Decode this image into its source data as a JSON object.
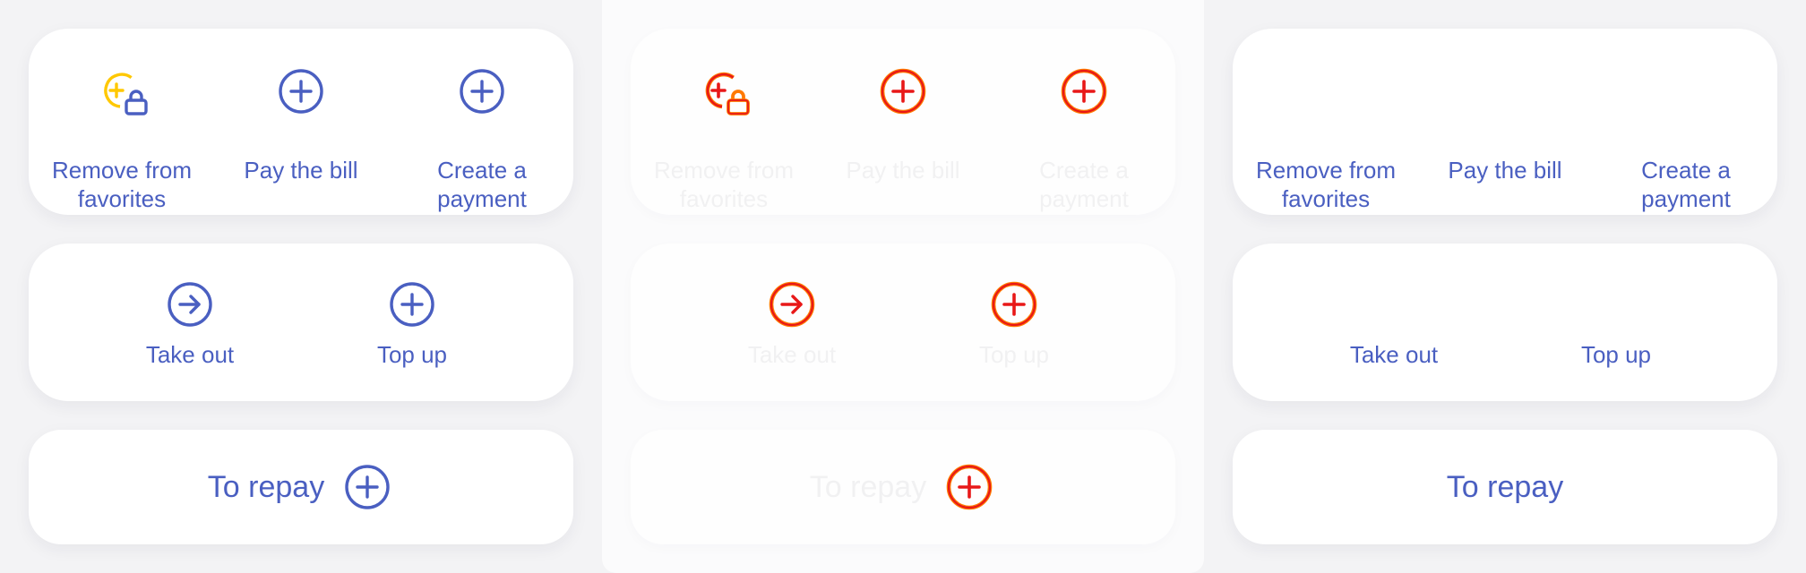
{
  "colors": {
    "blue": "#4a5fc1",
    "red": "#e81818",
    "orange": "#ff7a00",
    "yellow": "#ffc800",
    "faded_text": "#f1f1f2",
    "card": "#ffffff",
    "background": "#f3f3f5"
  },
  "variants": [
    {
      "top_card": [
        {
          "label": "Remove from favorites",
          "icon": "add-lock-icon"
        },
        {
          "label": "Pay the bill",
          "icon": "plus-circle-icon"
        },
        {
          "label": "Create a payment",
          "icon": "plus-circle-icon"
        }
      ],
      "mid_card": [
        {
          "label": "Take out",
          "icon": "arrow-right-circle-icon"
        },
        {
          "label": "Top up",
          "icon": "plus-circle-icon"
        }
      ],
      "bottom_card": {
        "label": "To repay",
        "icon": "plus-circle-icon"
      }
    },
    {
      "top_card": [
        {
          "label": "Remove from favorites",
          "icon": "add-lock-icon"
        },
        {
          "label": "Pay the bill",
          "icon": "plus-circle-icon"
        },
        {
          "label": "Create a payment",
          "icon": "plus-circle-icon"
        }
      ],
      "mid_card": [
        {
          "label": "Take out",
          "icon": "arrow-right-circle-icon"
        },
        {
          "label": "Top up",
          "icon": "plus-circle-icon"
        }
      ],
      "bottom_card": {
        "label": "To repay",
        "icon": "plus-circle-icon"
      }
    },
    {
      "top_card": [
        {
          "label": "Remove from favorites"
        },
        {
          "label": "Pay the bill"
        },
        {
          "label": "Create a payment"
        }
      ],
      "mid_card": [
        {
          "label": "Take out"
        },
        {
          "label": "Top up"
        }
      ],
      "bottom_card": {
        "label": "To repay"
      }
    }
  ]
}
